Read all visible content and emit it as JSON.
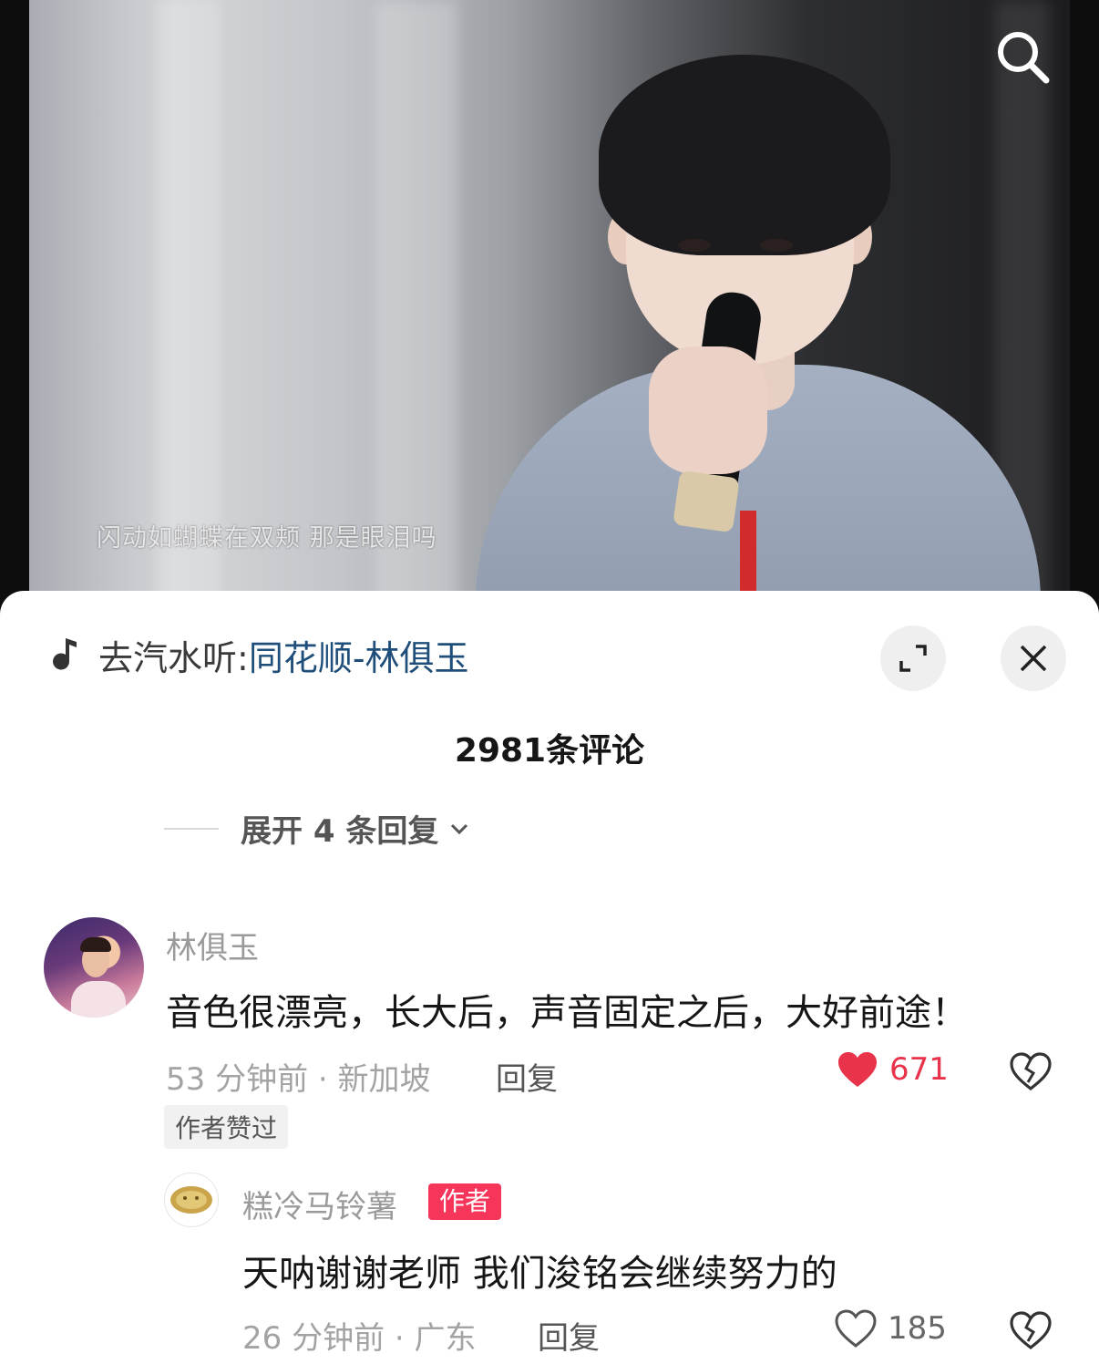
{
  "video": {
    "subtitle": "闪动如蝴蝶在双颊 那是眼泪吗",
    "search_icon": "search-icon"
  },
  "sheet": {
    "music_prefix": "去汽水听:",
    "music_song": "同花顺-林俱玉",
    "comment_count_title": "2981条评论",
    "expand_replies_label": "展开 4 条回复"
  },
  "comment": {
    "author": "林俱玉",
    "text": "音色很漂亮，长大后，声音固定之后，大好前途！",
    "meta": "53 分钟前 · 新加坡",
    "reply_label": "回复",
    "likes": "671",
    "liked": true,
    "author_liked_badge": "作者赞过"
  },
  "reply": {
    "author": "糕冷马铃薯",
    "author_tag": "作者",
    "text": "天呐谢谢老师 我们浚铭会继续努力的",
    "meta": "26 分钟前 · 广东",
    "reply_label": "回复",
    "likes": "185",
    "liked": false
  },
  "colors": {
    "like_red": "#e8334a",
    "author_tag_bg": "#f5355a",
    "song_link": "#1f4e7a"
  }
}
